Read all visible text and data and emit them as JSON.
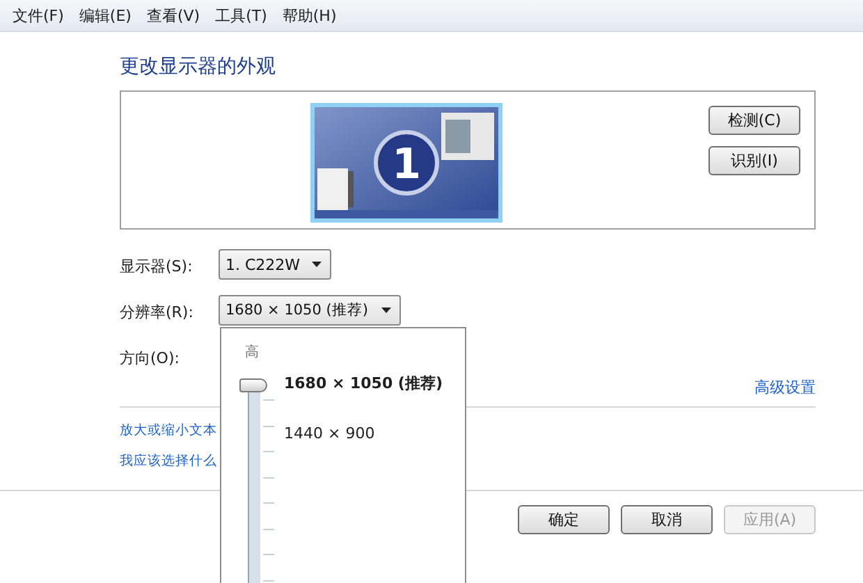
{
  "menu": [
    "文件(F)",
    "编辑(E)",
    "查看(V)",
    "工具(T)",
    "帮助(H)"
  ],
  "title": "更改显示器的外观",
  "preview": {
    "monitor_number": "1",
    "buttons": [
      {
        "label": "检测(C)"
      },
      {
        "label": "识别(I)"
      }
    ]
  },
  "fields": [
    {
      "label": "显示器(S):",
      "value": "1. C222W"
    },
    {
      "label": "分辨率(R):",
      "value": "1680 × 1050 (推荐)",
      "expanded": true
    },
    {
      "label": "方向(O):"
    }
  ],
  "resolution_popup": {
    "top_label": "高",
    "level": 1,
    "options": [
      {
        "label": "1680 × 1050 (推荐)",
        "selected": true
      },
      {
        "label": "1440 × 900",
        "selected": false
      }
    ]
  },
  "advanced_link": "高级设置",
  "links": [
    "放大或缩小文本",
    "我应该选择什么"
  ],
  "buttons": [
    {
      "label": "确定",
      "disabled": false
    },
    {
      "label": "取消",
      "disabled": false
    },
    {
      "label": "应用(A)",
      "disabled": true
    }
  ]
}
